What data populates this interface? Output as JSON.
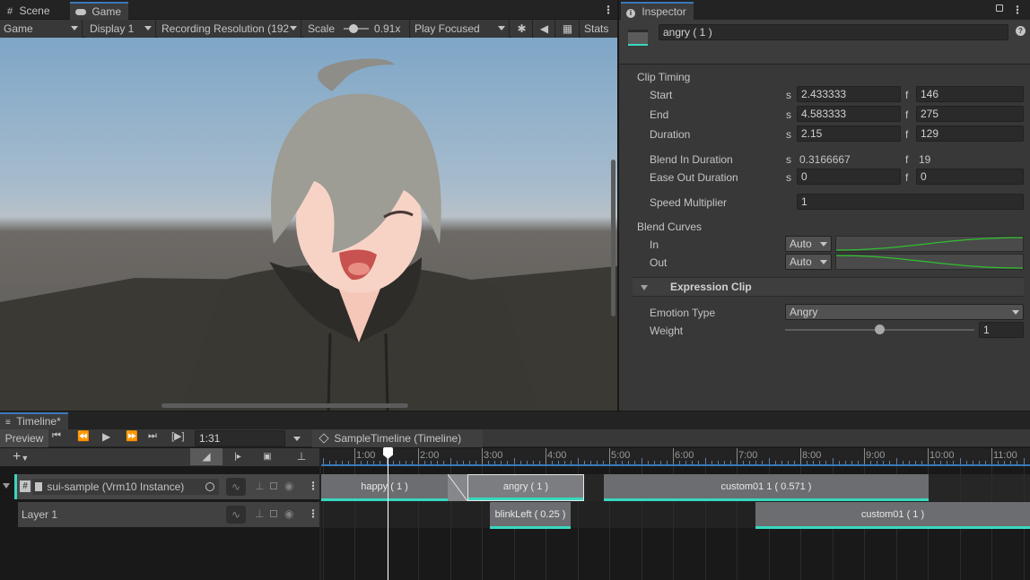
{
  "colors": {
    "accent": "#37d8bf",
    "selection": "#3a79bb",
    "timeline_bg": "#191919",
    "panel_bg": "#383838"
  },
  "tabs": {
    "scene": "Scene",
    "game": "Game",
    "inspector": "Inspector",
    "timeline": "Timeline*"
  },
  "game_toolbar": {
    "display_mode": "Game",
    "display": "Display 1",
    "resolution": "Recording Resolution (192",
    "scale_label": "Scale",
    "scale_value": "0.91x",
    "play_mode": "Play Focused",
    "stats": "Stats"
  },
  "inspector": {
    "object_name": "angry ( 1 )",
    "clip_timing_header": "Clip Timing",
    "rows": {
      "start": {
        "label": "Start",
        "s": "2.433333",
        "f": "146"
      },
      "end": {
        "label": "End",
        "s": "4.583333",
        "f": "275"
      },
      "duration": {
        "label": "Duration",
        "s": "2.15",
        "f": "129"
      },
      "blend_in": {
        "label": "Blend In Duration",
        "s": "0.3166667",
        "f": "19"
      },
      "ease_out": {
        "label": "Ease Out Duration",
        "s": "0",
        "f": "0"
      }
    },
    "s_unit": "s",
    "f_unit": "f",
    "speed_label": "Speed Multiplier",
    "speed_value": "1",
    "blend_curves_header": "Blend Curves",
    "in_label": "In",
    "in_mode": "Auto",
    "out_label": "Out",
    "out_mode": "Auto",
    "expression_clip_header": "Expression Clip",
    "emotion_type_label": "Emotion Type",
    "emotion_type_value": "Angry",
    "weight_label": "Weight",
    "weight_value": "1",
    "weight_fraction": 1
  },
  "timeline": {
    "preview": "Preview",
    "time_field": "1:31",
    "asset_name": "SampleTimeline (Timeline)",
    "ruler_ticks": [
      "1:00",
      "2:00",
      "3:00",
      "4:00",
      "5:00",
      "6:00",
      "7:00",
      "8:00",
      "9:00",
      "10:00",
      "11:00"
    ],
    "tracks": [
      {
        "name": "sui-sample (Vrm10 Instance)"
      },
      {
        "name": "Layer 1"
      }
    ],
    "clips_track1": [
      "happy ( 1 )",
      "angry ( 1 )",
      "custom01 1 ( 0.571 )"
    ],
    "clips_track2": [
      "blinkLeft ( 0.25 )",
      "custom01 ( 1 )"
    ]
  }
}
